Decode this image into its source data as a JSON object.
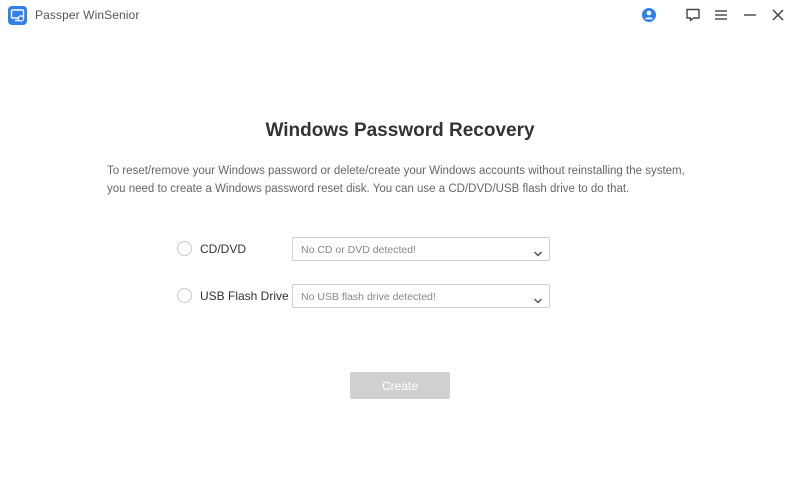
{
  "app": {
    "title": "Passper WinSenior"
  },
  "titlebar": {
    "icons": [
      "account-icon",
      "feedback-icon",
      "menu-icon",
      "minimize-icon",
      "close-icon"
    ],
    "accent_color": "#2f80ed"
  },
  "main": {
    "title": "Windows Password Recovery",
    "description_lines": [
      "To reset/remove your Windows password or delete/create your Windows accounts without reinstalling the system,",
      "you need to create a Windows password reset disk. You can use a CD/DVD/USB flash drive to do that."
    ],
    "options": [
      {
        "label": "CD/DVD",
        "selected": false,
        "dropdown_value": "No CD or DVD detected!"
      },
      {
        "label": "USB Flash Drive",
        "selected": false,
        "dropdown_value": "No USB flash drive detected!"
      }
    ],
    "create_button": {
      "label": "Create",
      "disabled": true,
      "color": "#cfd0d2"
    }
  }
}
